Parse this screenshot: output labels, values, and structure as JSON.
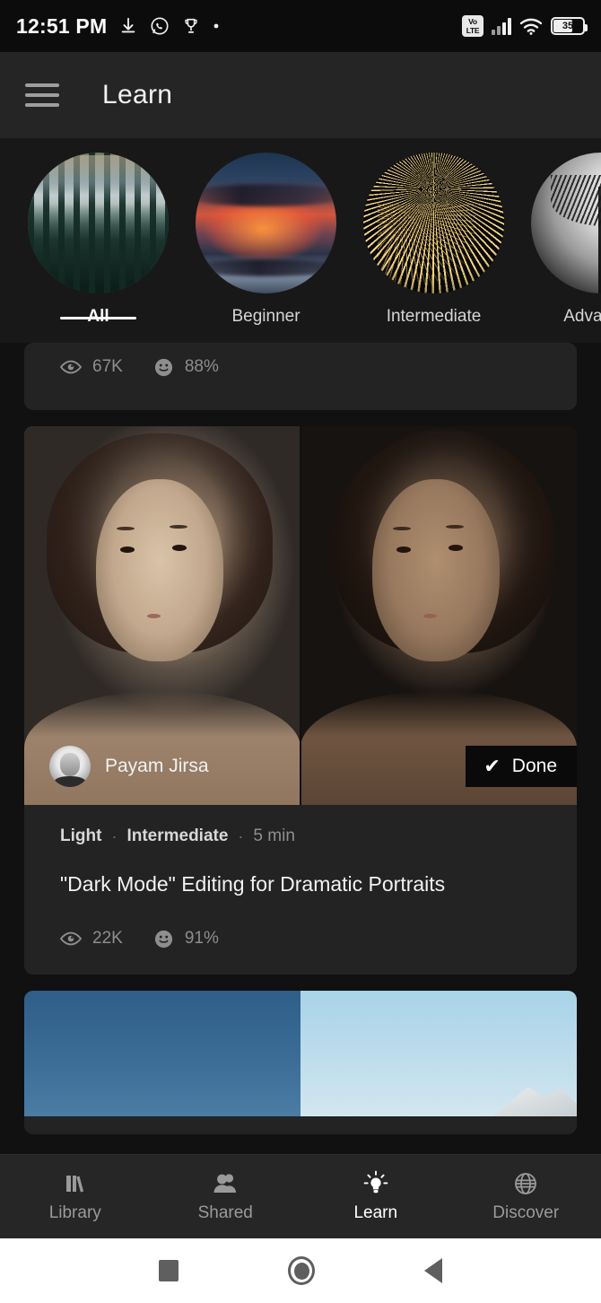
{
  "status_bar": {
    "time": "12:51 PM",
    "left_icons": [
      "download-icon",
      "whatsapp-icon",
      "trophy-icon",
      "dot-icon"
    ],
    "volte_label": "Vo\nLTE",
    "volte_line1": "Vo",
    "volte_line2": "LTE",
    "battery_level": "35",
    "right_icons": [
      "volte-icon",
      "signal-icon",
      "wifi-icon",
      "battery-icon"
    ]
  },
  "app_bar": {
    "menu_icon": "hamburger-icon",
    "title": "Learn"
  },
  "categories": [
    {
      "label": "All",
      "thumb": "forest-lake-reflection",
      "active": true
    },
    {
      "label": "Beginner",
      "thumb": "sunset-clouds",
      "active": false
    },
    {
      "label": "Intermediate",
      "thumb": "fireworks",
      "active": false
    },
    {
      "label": "Advanced",
      "truncated_label": "Advan",
      "thumb": "bw-abstract-architecture",
      "active": false
    }
  ],
  "partial_card_top": {
    "views_icon": "eye-icon",
    "views": "67K",
    "rating_icon": "smiley-icon",
    "rating": "88%"
  },
  "tutorial_card": {
    "media": {
      "type": "before-after-split",
      "before_alt": "portrait-before-light",
      "after_alt": "portrait-after-dark"
    },
    "author": {
      "name": "Payam Jirsa",
      "avatar_alt": "author-avatar"
    },
    "done_badge": {
      "check_glyph": "✔",
      "label": "Done"
    },
    "meta": {
      "topic": "Light",
      "separator": "·",
      "level": "Intermediate",
      "duration": "5 min"
    },
    "title": "\"Dark Mode\" Editing for Dramatic Portraits",
    "views_icon": "eye-icon",
    "views": "22K",
    "rating_icon": "smiley-icon",
    "rating": "91%"
  },
  "next_card_peek": {
    "media_alt": "sky-before-after-mountain"
  },
  "bottom_nav": [
    {
      "label": "Library",
      "icon": "books-icon",
      "active": false
    },
    {
      "label": "Shared",
      "icon": "people-icon",
      "active": false
    },
    {
      "label": "Learn",
      "icon": "lightbulb-icon",
      "active": true
    },
    {
      "label": "Discover",
      "icon": "globe-icon",
      "active": false
    }
  ],
  "android_nav": {
    "recents": "square-icon",
    "home": "circle-icon",
    "back": "triangle-back-icon"
  },
  "colors": {
    "page_bg": "#111111",
    "card_bg": "#232323",
    "appbar_bg": "#252525",
    "accent": "#ffffff",
    "muted_text": "#8e8e8e"
  }
}
